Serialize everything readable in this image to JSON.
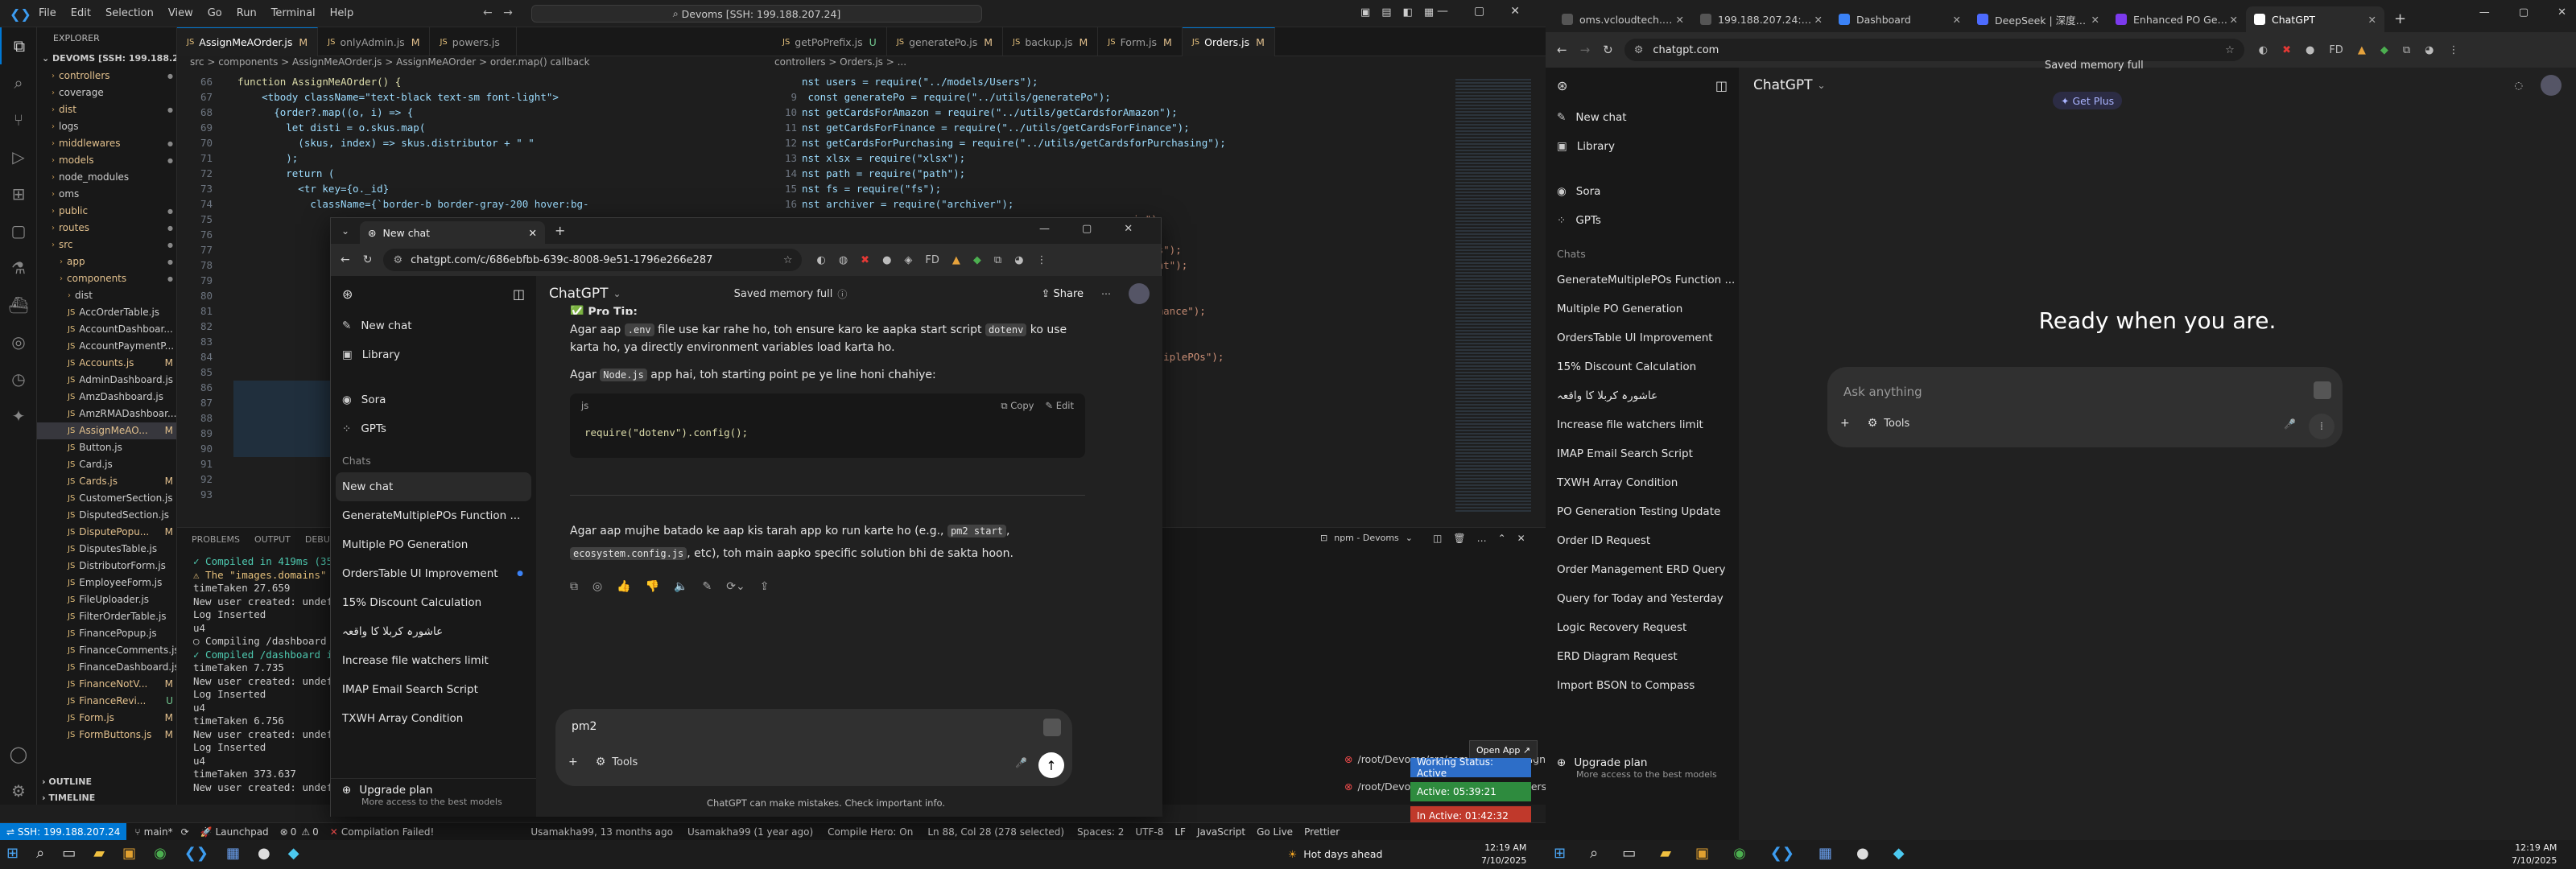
{
  "vscode": {
    "menu": [
      "File",
      "Edit",
      "Selection",
      "View",
      "Go",
      "Run",
      "Terminal",
      "Help"
    ],
    "search": "Devoms [SSH: 199.188.207.24]",
    "tabs1": [
      {
        "label": "AssignMeAOrder.js",
        "m": "M",
        "act": true
      },
      {
        "label": "onlyAdmin.js",
        "m": "M"
      },
      {
        "label": "powers.js",
        "m": ""
      }
    ],
    "tabs2": [
      {
        "label": "getPoPrefix.js",
        "m": "U"
      },
      {
        "label": "generatePo.js",
        "m": "M"
      },
      {
        "label": "backup.js",
        "m": "M"
      },
      {
        "label": "Form.js",
        "m": "M"
      },
      {
        "label": "Orders.js",
        "m": "M",
        "act": true
      }
    ],
    "crumb1": "src > components > AssignMeAOrder.js > AssignMeAOrder > order.map() callback",
    "crumb2": "controllers > Orders.js > ...",
    "explorer_title": "EXPLORER",
    "root": "DEVOMS [SSH: 199.188.20...",
    "tree": [
      {
        "t": "controllers",
        "d": 1,
        "folder": true,
        "mod": true
      },
      {
        "t": "coverage",
        "d": 1,
        "folder": true
      },
      {
        "t": "dist",
        "d": 1,
        "folder": true,
        "mod": true
      },
      {
        "t": "logs",
        "d": 1,
        "folder": true
      },
      {
        "t": "middlewares",
        "d": 1,
        "folder": true,
        "mod": true
      },
      {
        "t": "models",
        "d": 1,
        "folder": true,
        "mod": true
      },
      {
        "t": "node_modules",
        "d": 1,
        "folder": true
      },
      {
        "t": "oms",
        "d": 1,
        "folder": true
      },
      {
        "t": "public",
        "d": 1,
        "folder": true,
        "mod": true
      },
      {
        "t": "routes",
        "d": 1,
        "folder": true,
        "mod": true
      },
      {
        "t": "src",
        "d": 1,
        "folder": true,
        "mod": true
      },
      {
        "t": "app",
        "d": 2,
        "folder": true,
        "mod": true
      },
      {
        "t": "components",
        "d": 2,
        "folder": true,
        "mod": true
      },
      {
        "t": "dist",
        "d": 3,
        "folder": true
      },
      {
        "t": "AccOrderTable.js",
        "d": 3
      },
      {
        "t": "AccountDashboar...",
        "d": 3
      },
      {
        "t": "AccountPaymentP...",
        "d": 3
      },
      {
        "t": "Accounts.js",
        "d": 3,
        "mod": true,
        "m": "M"
      },
      {
        "t": "AdminDashboard.js",
        "d": 3
      },
      {
        "t": "AmzDashboard.js",
        "d": 3
      },
      {
        "t": "AmzRMADashboar...",
        "d": 3
      },
      {
        "t": "AssignMeAO...",
        "d": 3,
        "mod": true,
        "m": "M",
        "sel": true
      },
      {
        "t": "Button.js",
        "d": 3
      },
      {
        "t": "Card.js",
        "d": 3
      },
      {
        "t": "Cards.js",
        "d": 3,
        "mod": true,
        "m": "M"
      },
      {
        "t": "CustomerSection.js",
        "d": 3
      },
      {
        "t": "DisputedSection.js",
        "d": 3
      },
      {
        "t": "DisputePopu...",
        "d": 3,
        "mod": true,
        "m": "M"
      },
      {
        "t": "DisputesTable.js",
        "d": 3
      },
      {
        "t": "DistributorForm.js",
        "d": 3
      },
      {
        "t": "EmployeeForm.js",
        "d": 3
      },
      {
        "t": "FileUploader.js",
        "d": 3
      },
      {
        "t": "FilterOrderTable.js",
        "d": 3
      },
      {
        "t": "FinancePopup.js",
        "d": 3
      },
      {
        "t": "FinanceComments.js",
        "d": 3
      },
      {
        "t": "FinanceDashboard.js",
        "d": 3
      },
      {
        "t": "FinanceNotV...",
        "d": 3,
        "mod": true,
        "m": "M"
      },
      {
        "t": "FinanceRevi...",
        "d": 3,
        "mod": true,
        "m": "U"
      },
      {
        "t": "Form.js",
        "d": 3,
        "mod": true,
        "m": "M"
      },
      {
        "t": "FormButtons.js",
        "d": 3,
        "mod": true,
        "m": "M"
      }
    ],
    "outline": "OUTLINE",
    "timeline": "TIMELINE",
    "code1": [
      {
        "n": "66",
        "c": "  function AssignMeAOrder() {"
      },
      {
        "n": "67",
        "c": "      <tbody className=\"text-black text-sm font-light\">"
      },
      {
        "n": "68",
        "c": "        {order?.map((o, i) => {"
      },
      {
        "n": "69",
        "c": "          let disti = o.skus.map("
      },
      {
        "n": "70",
        "c": "            (skus, index) => skus.distributor + \" \""
      },
      {
        "n": "71",
        "c": "          );"
      },
      {
        "n": "72",
        "c": "          return ("
      },
      {
        "n": "73",
        "c": "            <tr key={o._id}"
      },
      {
        "n": "74",
        "c": "              className={`border-b border-gray-200 hover:bg-"
      },
      {
        "n": "75",
        "c": ""
      },
      {
        "n": "76",
        "c": ""
      },
      {
        "n": "77",
        "c": ""
      },
      {
        "n": "78",
        "c": ""
      },
      {
        "n": "79",
        "c": ""
      },
      {
        "n": "80",
        "c": ""
      },
      {
        "n": "81",
        "c": ""
      },
      {
        "n": "82",
        "c": ""
      },
      {
        "n": "83",
        "c": ""
      },
      {
        "n": "84",
        "c": ""
      },
      {
        "n": "85",
        "c": ""
      },
      {
        "n": "86",
        "c": ""
      },
      {
        "n": "87",
        "c": ""
      },
      {
        "n": "88",
        "c": ""
      },
      {
        "n": "89",
        "c": ""
      },
      {
        "n": "90",
        "c": ""
      },
      {
        "n": "91",
        "c": ""
      },
      {
        "n": "92",
        "c": ""
      },
      {
        "n": "93",
        "c": ""
      }
    ],
    "code2": [
      {
        "n": "",
        "c": "nst users = require(\"../models/Users\");"
      },
      {
        "n": "9",
        "c": " const generatePo = require(\"../utils/generatePo\");"
      },
      {
        "n": "10",
        "c": "nst getCardsForAmazon = require(\"../utils/getCardsforAmazon\");"
      },
      {
        "n": "11",
        "c": "nst getCardsForFinance = require(\"../utils/getCardsForFinance\");"
      },
      {
        "n": "12",
        "c": "nst getCardsForPurchasing = require(\"../utils/getCardsforPurchasing\");"
      },
      {
        "n": "13",
        "c": "nst xlsx = require(\"xlsx\");"
      },
      {
        "n": "14",
        "c": "nst path = require(\"path\");"
      },
      {
        "n": "15",
        "c": "nst fs = require(\"fs\");"
      },
      {
        "n": "16",
        "c": "nst archiver = require(\"archiver\");"
      }
    ],
    "code2_tail": [
      {
        "c": "min\");"
      },
      {
        "c": ""
      },
      {
        "c": "te-fns\");"
      },
      {
        "c": "Account\");"
      },
      {
        "c": ""
      },
      {
        "c": ""
      },
      {
        "c": "erformance\");"
      },
      {
        "c": ""
      },
      {
        "c": ""
      },
      {
        "c": "teMultiplePOs\");"
      }
    ],
    "panel_tabs": [
      "PROBLEMS",
      "OUTPUT",
      "DEBUG CONSOLE"
    ],
    "npm_label": "npm - Devoms",
    "terminal": [
      "✓ Compiled in 419ms (3559 m",
      "⚠ The \"images.domains\" co",
      "timeTaken 27.659",
      "New user created: undefi",
      "Log Inserted",
      "u4",
      "○ Compiling /dashboard ...",
      "✓ Compiled /dashboard in",
      "timeTaken 7.735",
      "New user created: undefi",
      "Log Inserted",
      "u4",
      "timeTaken 6.756",
      "New user created: undefi",
      "Log Inserted",
      "u4",
      "timeTaken 373.637",
      "New user created: undefi"
    ],
    "terminal_paths": [
      "/root/Devoms/src/components/AssignMeAO...",
      "/root/Devoms/src/components/OrdersTable..."
    ],
    "toasts": {
      "open_app": "Open App ↗",
      "working": "Working Status: Active",
      "active": "Active: 05:39:21",
      "inactive": "In Active: 01:42:32"
    },
    "status": {
      "remote": "SSH: 199.188.207.24",
      "branch": "main*",
      "sync": "⟳",
      "launchpad": "Launchpad",
      "errors": "0",
      "warnings": "0",
      "compile": "Compilation Failed!",
      "blame1": "Usamakha99, 13 months ago",
      "blame2": "Usamakha99 (1 year ago)",
      "compile_hero": "Compile Hero: On",
      "pos": "Ln 88, Col 28 (278 selected)",
      "spaces": "Spaces: 2",
      "enc": "UTF-8",
      "eol": "LF",
      "lang": "JavaScript",
      "golive": "Go Live",
      "prettier": "Prettier",
      "hot": "Hot days ahead"
    }
  },
  "chromeS": {
    "tab": "New chat",
    "url": "chatgpt.com/c/686ebfbb-639c-8008-9e51-1796e266e287",
    "model": "ChatGPT",
    "memory": "Saved memory full",
    "share": "Share",
    "nav": [
      {
        "l": "New chat",
        "i": "✎"
      },
      {
        "l": "Library",
        "i": "▣"
      },
      {
        "l": "Sora",
        "i": "◉"
      },
      {
        "l": "GPTs",
        "i": "⁘"
      }
    ],
    "chats_label": "Chats",
    "chats": [
      "New chat",
      "GenerateMultiplePOs Function ...",
      "Multiple PO Generation",
      "OrdersTable UI Improvement",
      "15% Discount Calculation",
      "عاشورہ کربلا کا واقعہ",
      "Increase file watchers limit",
      "IMAP Email Search Script",
      "TXWH Array Condition"
    ],
    "upgrade": "Upgrade plan",
    "upgrade_sub": "More access to the best models",
    "heading": "Pro Tip:",
    "p1a": "Agar aap ",
    "p1code": ".env",
    "p1b": " file use kar rahe ho, toh ensure karo ke aapka start script ",
    "p1code2": "dotenv",
    "p1c": " ko use karta ho, ya directly environment variables load karta ho.",
    "p2a": "Agar ",
    "p2code": "Node.js",
    "p2b": " app hai, toh starting point pe ye line honi chahiye:",
    "code_lang": "js",
    "copy": "Copy",
    "edit": "Edit",
    "code_line": "require(\"dotenv\").config();",
    "p3a": "Agar aap mujhe batado ke aap kis tarah app ko run karte ho (e.g., ",
    "p3code": "pm2 start",
    "p3b": ", ",
    "p3code2": "ecosystem.config.js",
    "p3c": ", etc), toh main aapko specific solution bhi de sakta hoon.",
    "input": "pm2",
    "tools": "Tools",
    "footer": "ChatGPT can make mistakes. Check important info."
  },
  "chromeR": {
    "tabs": [
      {
        "l": "oms.vcloudtech.u...",
        "c": "#555"
      },
      {
        "l": "199.188.207.24:10...",
        "c": "#555"
      },
      {
        "l": "Dashboard",
        "c": "#3b82f6"
      },
      {
        "l": "DeepSeek | 深度求...",
        "c": "#4d6bfe"
      },
      {
        "l": "Enhanced PO Gen...",
        "c": "#7c3aed"
      },
      {
        "l": "ChatGPT",
        "c": "#fff",
        "act": true
      }
    ],
    "url": "chatgpt.com",
    "model": "ChatGPT",
    "memory": "Saved memory full",
    "getplus": "Get Plus",
    "nav": [
      {
        "l": "New chat",
        "i": "✎"
      },
      {
        "l": "Library",
        "i": "▣"
      },
      {
        "l": "Sora",
        "i": "◉"
      },
      {
        "l": "GPTs",
        "i": "⁘"
      }
    ],
    "chats_label": "Chats",
    "chats": [
      "GenerateMultiplePOs Function ...",
      "Multiple PO Generation",
      "OrdersTable UI Improvement",
      "15% Discount Calculation",
      "عاشورہ کربلا کا واقعہ",
      "Increase file watchers limit",
      "IMAP Email Search Script",
      "TXWH Array Condition",
      "PO Generation Testing Update",
      "Order ID Request",
      "Order Management ERD Query",
      "Query for Today and Yesterday",
      "Logic Recovery Request",
      "ERD Diagram Request",
      "Import BSON to Compass"
    ],
    "upgrade": "Upgrade plan",
    "upgrade_sub": "More access to the best models",
    "hero": "Ready when you are.",
    "placeholder": "Ask anything",
    "tools": "Tools"
  },
  "taskbar": {
    "time": "12:19 AM",
    "date": "7/10/2025",
    "time2": "12:19 AM",
    "date2": "7/10/2025"
  }
}
